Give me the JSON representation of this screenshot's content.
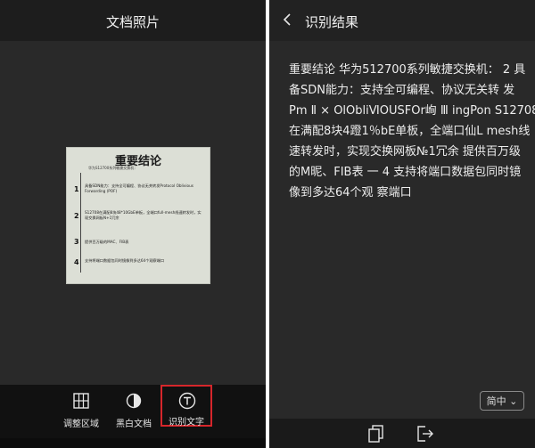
{
  "left": {
    "header_title": "文档照片",
    "document": {
      "title": "重要结论",
      "subtitle": "华为S12700系列敏捷交换机：",
      "items": [
        {
          "num": "1",
          "text": "具备SDN能力：支持全可编程、协议无关转发Protocol Oblivious Forwarding (POF)"
        },
        {
          "num": "2",
          "text": "S12708在满配8块48*10GbE单板，全端口full-mesh线速转发时，实现交换网板N+1冗余"
        },
        {
          "num": "3",
          "text": "提供百万级的MAC、FIB表"
        },
        {
          "num": "4",
          "text": "支持将端口数据包同时镜像到多达64个观察端口"
        }
      ]
    },
    "toolbar": {
      "adjust_label": "调整区域",
      "bw_label": "黑白文档",
      "ocr_label": "识别文字"
    }
  },
  "right": {
    "header_title": "识别结果",
    "result_lines": [
      "重要结论  华为512700系列敏捷交换机： 2 具",
      "备SDN能力：支持全可编程、协议无关转 发",
      "Pm Ⅱ × OlObliⅥOUSFOr峋 Ⅲ ingPon  S12708",
      "在满配8块4蹬1％bE单板，全端口仙L mesh线",
      "速转发时，实现交换网板№1冗余   提供百万级",
      "的M昵、FIB表 一  4  支持将端口数据包同时镜",
      "像到多达64个观 察端口"
    ],
    "lang_button": "简中 ⌄"
  },
  "colors": {
    "ocr_highlight": "#d6262b",
    "background": "#262626"
  }
}
